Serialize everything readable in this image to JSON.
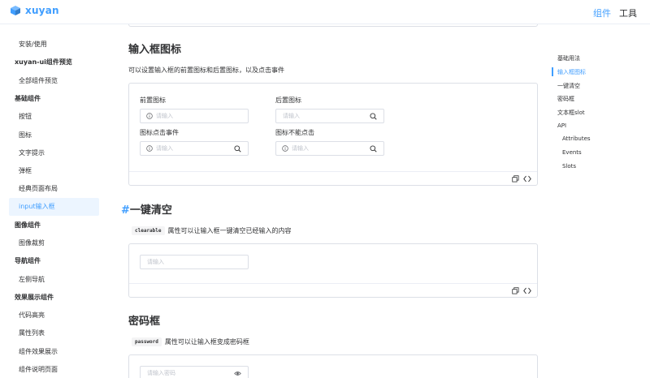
{
  "header": {
    "logo_text": "xuyan",
    "nav": [
      "组件",
      "工具"
    ]
  },
  "sidebar": {
    "entries": [
      {
        "type": "item",
        "label": "安装/使用"
      },
      {
        "type": "group",
        "label": "xuyan-ui组件预览"
      },
      {
        "type": "item",
        "label": "全部组件预览"
      },
      {
        "type": "group",
        "label": "基础组件"
      },
      {
        "type": "item",
        "label": "按钮"
      },
      {
        "type": "item",
        "label": "图标"
      },
      {
        "type": "item",
        "label": "文字提示"
      },
      {
        "type": "item",
        "label": "弹框"
      },
      {
        "type": "item",
        "label": "经典页面布局"
      },
      {
        "type": "item",
        "label": "input输入框",
        "active": true
      },
      {
        "type": "group",
        "label": "图像组件"
      },
      {
        "type": "item",
        "label": "图像裁剪"
      },
      {
        "type": "group",
        "label": "导航组件"
      },
      {
        "type": "item",
        "label": "左侧导航"
      },
      {
        "type": "group",
        "label": "效果展示组件"
      },
      {
        "type": "item",
        "label": "代码高亮"
      },
      {
        "type": "item",
        "label": "属性列表"
      },
      {
        "type": "item",
        "label": "组件效果展示"
      },
      {
        "type": "item",
        "label": "组件说明页面"
      }
    ]
  },
  "toc": {
    "items": [
      {
        "label": "基础用法"
      },
      {
        "label": "输入框图标",
        "active": true
      },
      {
        "label": "一键清空"
      },
      {
        "label": "密码框"
      },
      {
        "label": "文本框slot"
      },
      {
        "label": "API"
      },
      {
        "label": "Attributes",
        "sub": true
      },
      {
        "label": "Events",
        "sub": true
      },
      {
        "label": "Slots",
        "sub": true
      }
    ]
  },
  "section_icon": {
    "title": "输入框图标",
    "desc": "可以设置输入框的前置图标和后置图标，以及点击事件",
    "fields": [
      {
        "label": "前置图标",
        "placeholder": "请输入",
        "icon": "info-circle-icon",
        "icon_side": "prefix"
      },
      {
        "label": "后置图标",
        "placeholder": "请输入",
        "icon": "search-icon",
        "icon_side": "suffix"
      },
      {
        "label": "图标点击事件",
        "placeholder": "请输入",
        "icon": "info-circle-icon",
        "icon_side": "both"
      },
      {
        "label": "图标不能点击",
        "placeholder": "请输入",
        "icon": "info-circle-icon",
        "icon_side": "both"
      }
    ]
  },
  "section_clear": {
    "hash": "#",
    "title": "一键清空",
    "code": "clearable",
    "desc": "属性可以让输入框一键清空已经输入的内容",
    "placeholder": "请输入"
  },
  "section_password": {
    "title": "密码框",
    "code": "password",
    "desc": "属性可以让输入框变成密码框",
    "placeholder": "请输入密码"
  },
  "colors": {
    "accent": "#409eff",
    "border": "#dcdfe6",
    "placeholder": "#c0c4cc"
  }
}
